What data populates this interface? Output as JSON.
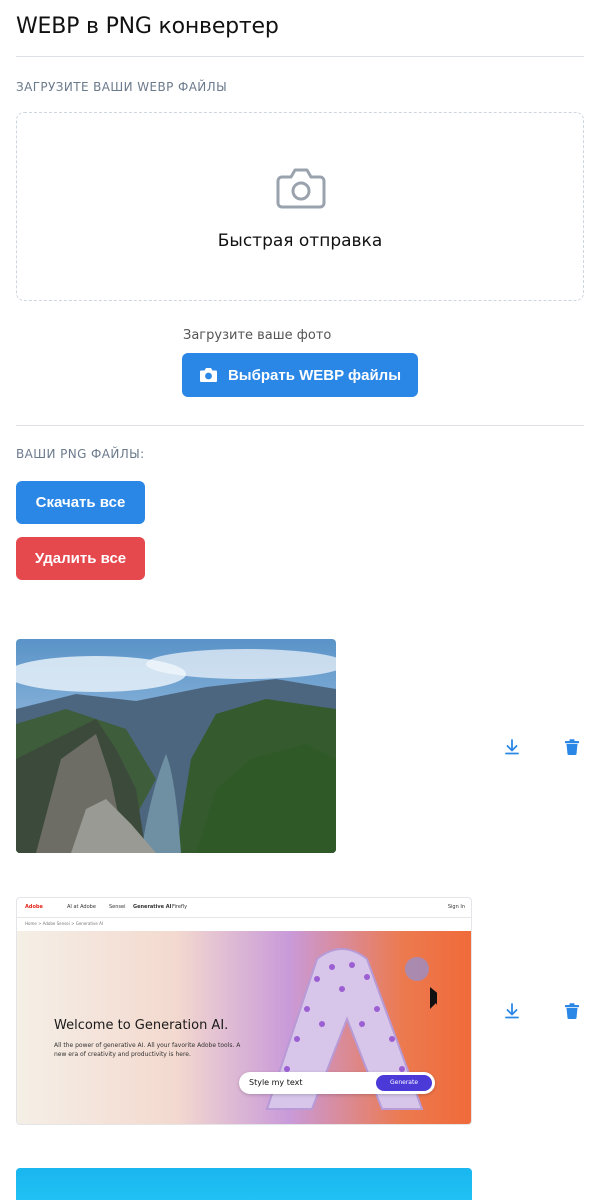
{
  "page": {
    "title": "WEBP в PNG конвертер"
  },
  "upload": {
    "section_label": "ЗАГРУЗИТЕ ВАШИ WEBP ФАЙЛЫ",
    "dropzone_text": "Быстрая отправка",
    "hint": "Загрузите ваше фото",
    "choose_button": "Выбрать WEBP файлы"
  },
  "results": {
    "section_label": "ВАШИ PNG ФАЙЛЫ:",
    "download_all": "Скачать все",
    "delete_all": "Удалить все"
  },
  "files": [
    {
      "kind": "landscape",
      "actions": [
        "download-icon",
        "trash-icon"
      ]
    },
    {
      "kind": "adobe-screenshot",
      "actions": [
        "download-icon",
        "trash-icon"
      ],
      "shot": {
        "logo": "Adobe",
        "nav": [
          "AI at Adobe",
          "Sensei",
          "Generative AI",
          "Firefly"
        ],
        "sign_in": "Sign In",
        "breadcrumb": "Home  >  Adobe Sensei  >  Generative AI",
        "headline": "Welcome to Generation AI.",
        "subtext": "All the power of generative AI. All your favorite Adobe tools. A new era of creativity and productivity is here.",
        "prompt_text": "Style my text",
        "prompt_button": "Generate"
      }
    },
    {
      "kind": "cyan-image"
    }
  ],
  "colors": {
    "primary": "#2b87e6",
    "danger": "#e5484d",
    "muted": "#6b7a8c"
  }
}
